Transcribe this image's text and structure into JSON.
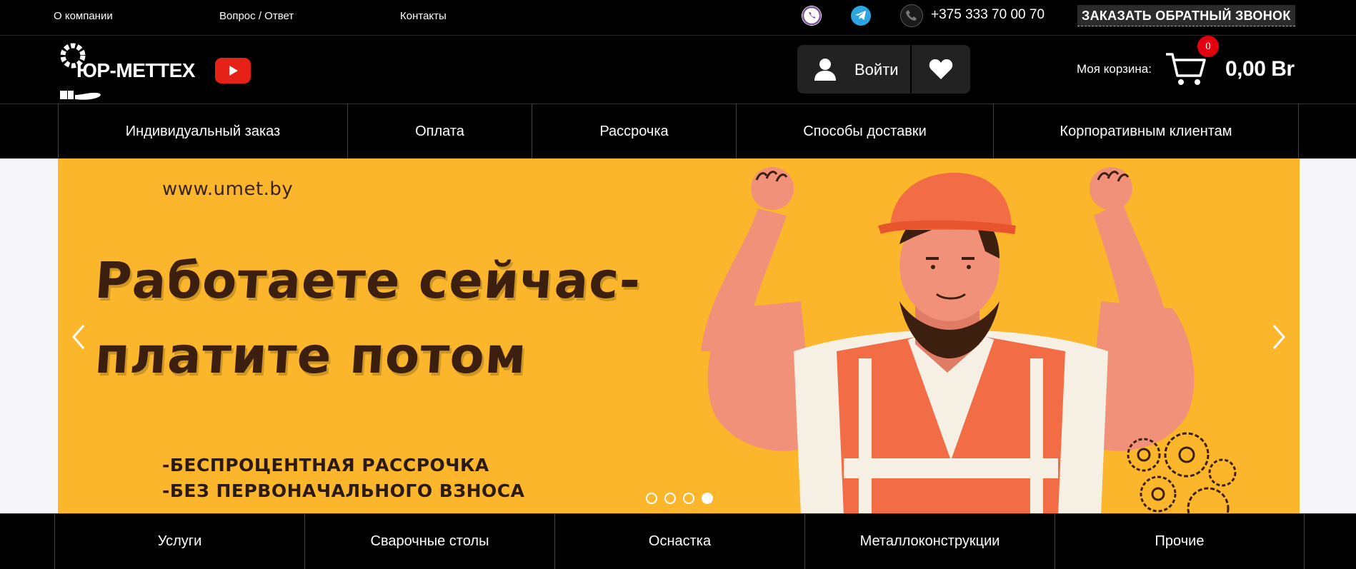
{
  "topbar": {
    "links": [
      "О компании",
      "Вопрос / Ответ",
      "Контакты"
    ],
    "phone": "+375 333 70 00 70",
    "callback_label": "ЗАКАЗАТЬ ОБРАТНЫЙ ЗВОНОК",
    "icons": [
      "viber-icon",
      "telegram-icon",
      "phone-icon"
    ]
  },
  "header": {
    "logo_text": "ЮР-МЕТТЕХ",
    "login_label": "Войти",
    "cart_label": "Моя корзина:",
    "cart_count": "0",
    "cart_total": "0,00 Br"
  },
  "nav": {
    "items": [
      "Индивидуальный заказ",
      "Оплата",
      "Рассрочка",
      "Способы доставки",
      "Корпоративным клиентам"
    ]
  },
  "banner": {
    "url": "www.umet.by",
    "headline_lines": [
      "Работаете сейчас-",
      "платите потом"
    ],
    "bullets": [
      "-БЕСПРОЦЕНТНАЯ РАССРОЧКА",
      "-БЕЗ ПЕРВОНАЧАЛЬНОГО ВЗНОСА"
    ],
    "slide_count": 4,
    "active_slide": 4
  },
  "categories": {
    "items": [
      "Услуги",
      "Сварочные столы",
      "Оснастка",
      "Металлоконструкции",
      "Прочие"
    ]
  },
  "colors": {
    "banner_bg": "#fbb62b",
    "headline": "#3d1f10",
    "cart_badge": "#e3000f",
    "youtube": "#e62117"
  }
}
